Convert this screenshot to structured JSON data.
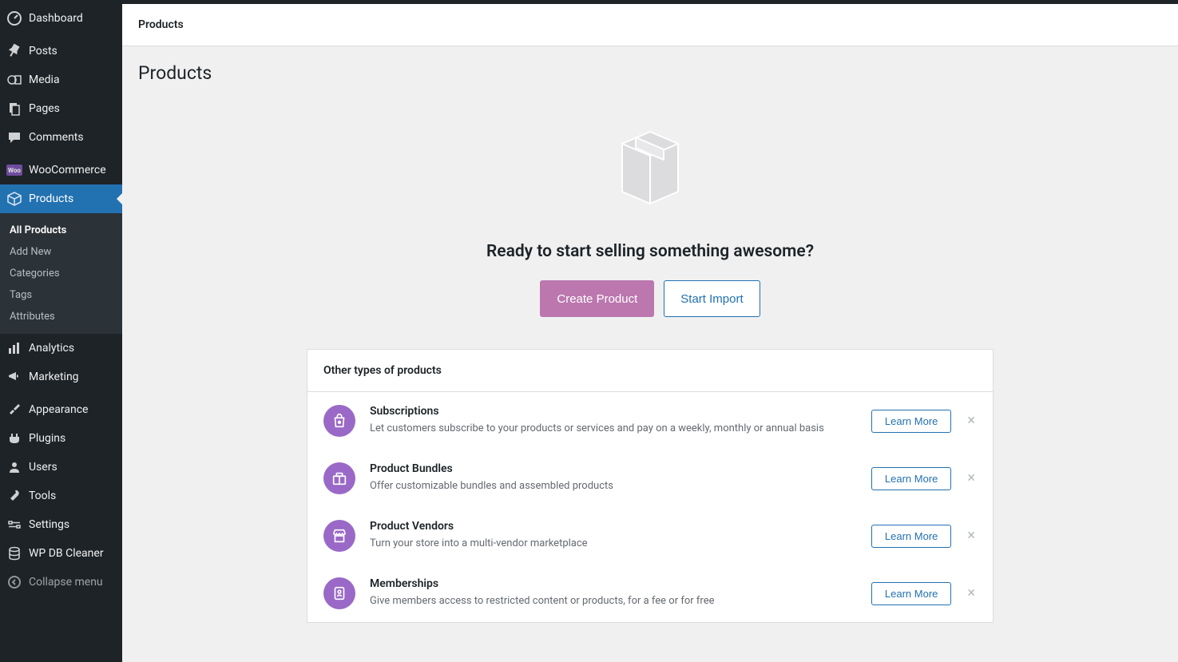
{
  "header": {
    "breadcrumb": "Products"
  },
  "page": {
    "title": "Products"
  },
  "sidebar": {
    "items": [
      {
        "label": "Dashboard",
        "icon": "dashboard-icon"
      },
      {
        "label": "Posts",
        "icon": "pin-icon"
      },
      {
        "label": "Media",
        "icon": "media-icon"
      },
      {
        "label": "Pages",
        "icon": "pages-icon"
      },
      {
        "label": "Comments",
        "icon": "comment-icon"
      },
      {
        "label": "WooCommerce",
        "icon": "woo-icon"
      },
      {
        "label": "Products",
        "icon": "product-icon"
      },
      {
        "label": "Analytics",
        "icon": "analytics-icon"
      },
      {
        "label": "Marketing",
        "icon": "marketing-icon"
      },
      {
        "label": "Appearance",
        "icon": "appearance-icon"
      },
      {
        "label": "Plugins",
        "icon": "plugins-icon"
      },
      {
        "label": "Users",
        "icon": "users-icon"
      },
      {
        "label": "Tools",
        "icon": "tools-icon"
      },
      {
        "label": "Settings",
        "icon": "settings-icon"
      },
      {
        "label": "WP DB Cleaner",
        "icon": "db-icon"
      },
      {
        "label": "Collapse menu",
        "icon": "collapse-icon"
      }
    ],
    "submenu": [
      {
        "label": "All Products",
        "current": true
      },
      {
        "label": "Add New"
      },
      {
        "label": "Categories"
      },
      {
        "label": "Tags"
      },
      {
        "label": "Attributes"
      }
    ]
  },
  "empty": {
    "headline": "Ready to start selling something awesome?",
    "create_label": "Create Product",
    "import_label": "Start Import"
  },
  "other": {
    "title": "Other types of products",
    "learn_label": "Learn More",
    "items": [
      {
        "title": "Subscriptions",
        "desc": "Let customers subscribe to your products or services and pay on a weekly, monthly or annual basis",
        "icon": "bag-icon"
      },
      {
        "title": "Product Bundles",
        "desc": "Offer customizable bundles and assembled products",
        "icon": "bundle-icon"
      },
      {
        "title": "Product Vendors",
        "desc": "Turn your store into a multi-vendor marketplace",
        "icon": "store-icon"
      },
      {
        "title": "Memberships",
        "desc": "Give members access to restricted content or products, for a fee or for free",
        "icon": "badge-icon"
      }
    ]
  }
}
